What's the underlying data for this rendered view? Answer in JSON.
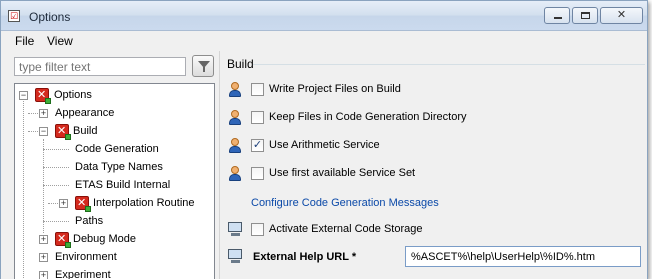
{
  "window": {
    "title": "Options"
  },
  "menu": {
    "file": "File",
    "view": "View"
  },
  "filter": {
    "placeholder": "type filter text"
  },
  "tree": {
    "root": "Options",
    "appearance": "Appearance",
    "build": "Build",
    "code_generation": "Code Generation",
    "data_type_names": "Data Type Names",
    "etas_build_internal": "ETAS Build Internal",
    "interpolation_routine": "Interpolation Routine",
    "paths": "Paths",
    "debug_mode": "Debug Mode",
    "environment": "Environment",
    "experiment": "Experiment"
  },
  "section": {
    "title": "Build"
  },
  "options": [
    {
      "label": "Write Project Files on Build",
      "checked": false
    },
    {
      "label": "Keep Files in Code Generation Directory",
      "checked": false
    },
    {
      "label": "Use Arithmetic Service",
      "checked": true
    },
    {
      "label": "Use first available Service Set",
      "checked": false
    }
  ],
  "link": {
    "label": "Configure Code Generation Messages"
  },
  "external_storage": {
    "label": "Activate External Code Storage",
    "checked": false
  },
  "help_url": {
    "label": "External Help URL *",
    "value": "%ASCET%\\help\\UserHelp\\%ID%.htm"
  },
  "icons": {
    "title": "options-window-icon",
    "user_scope": "person-icon",
    "machine_scope": "computer-icon"
  },
  "colors": {
    "link": "#0b49a8",
    "titlebar": "#cbdaee"
  }
}
